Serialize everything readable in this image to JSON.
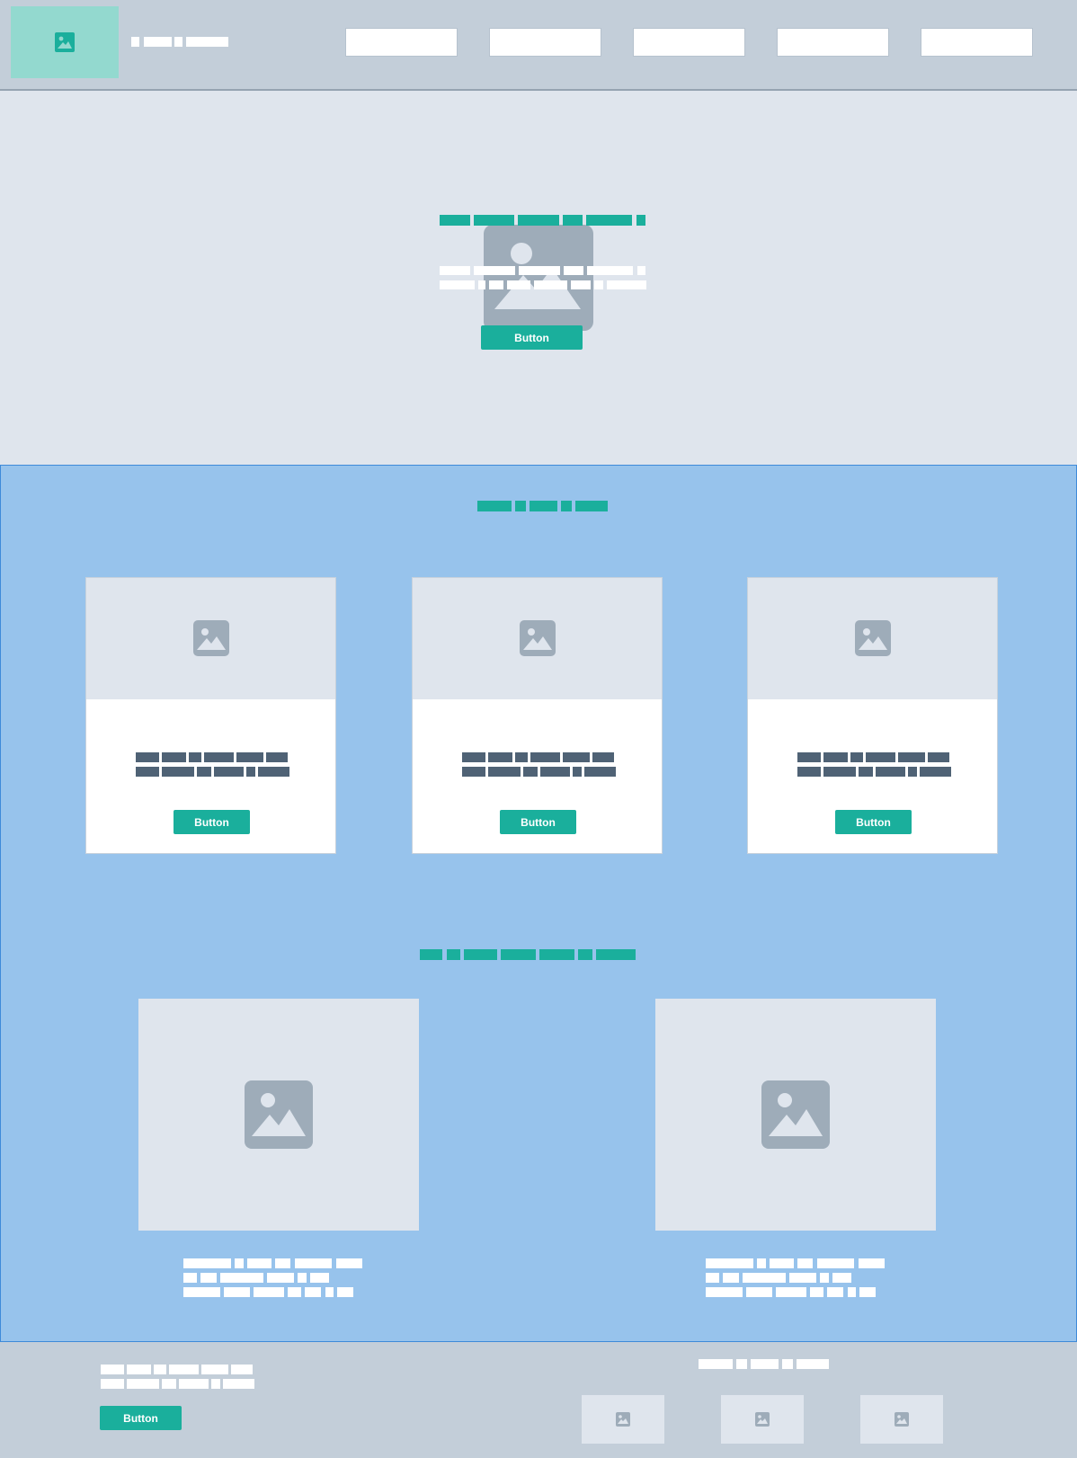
{
  "colors": {
    "accent": "#1aaf9c",
    "header_bg": "#c3ced9",
    "hero_bg": "#dfe5ed",
    "content_bg": "#97c3ec",
    "placeholder_icon": "#9eacb9",
    "card_text": "#4f6275"
  },
  "header": {
    "logo_icon": "image-placeholder-icon",
    "nav_items": [
      "",
      "",
      "",
      "",
      ""
    ]
  },
  "hero": {
    "image_icon": "image-placeholder-icon",
    "cta_label": "Button"
  },
  "cards": [
    {
      "icon": "image-placeholder-icon",
      "button_label": "Button"
    },
    {
      "icon": "image-placeholder-icon",
      "button_label": "Button"
    },
    {
      "icon": "image-placeholder-icon",
      "button_label": "Button"
    }
  ],
  "features": [
    {
      "icon": "image-placeholder-icon"
    },
    {
      "icon": "image-placeholder-icon"
    }
  ],
  "footer": {
    "button_label": "Button",
    "thumb_icons": [
      "image-placeholder-icon",
      "image-placeholder-icon",
      "image-placeholder-icon"
    ]
  }
}
